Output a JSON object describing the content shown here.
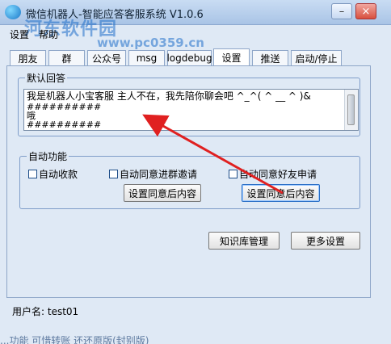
{
  "window": {
    "title": "微信机器人-智能应答客服系统 V1.0.6",
    "watermark": "河东软件园",
    "watermark_url": "www.pc0359.cn",
    "minimize_glyph": "–",
    "close_glyph": "×"
  },
  "menu": {
    "items": [
      "设置",
      "帮助"
    ]
  },
  "tabs": [
    {
      "label": "朋友",
      "active": false
    },
    {
      "label": "群",
      "active": false
    },
    {
      "label": "公众号",
      "active": false
    },
    {
      "label": "msg",
      "active": false
    },
    {
      "label": "logdebug",
      "active": false
    },
    {
      "label": "设置",
      "active": true
    },
    {
      "label": "推送",
      "active": false
    },
    {
      "label": "启动/停止",
      "active": false
    }
  ],
  "default_reply": {
    "legend": "默认回答",
    "lines": [
      "我是机器人小宝客服 主人不在，我先陪你聊会吧 ^_^( ^ __ ^ )&",
      "##########",
      "哦",
      "##########"
    ]
  },
  "auto": {
    "legend": "自动功能",
    "auto_collect": "自动收款",
    "auto_group": "自动同意进群邀请",
    "auto_friend": "自动同意好友申请",
    "set_group_btn": "设置同意后内容",
    "set_friend_btn": "设置同意后内容"
  },
  "actions": {
    "knowledge": "知识库管理",
    "more": "更多设置"
  },
  "status": {
    "username": "用户名: test01"
  },
  "bottom_text": "...功能 可惜转账 还还原版(封别版)",
  "colors": {
    "arrow": "#e02020",
    "accent": "#2a6fc6"
  }
}
